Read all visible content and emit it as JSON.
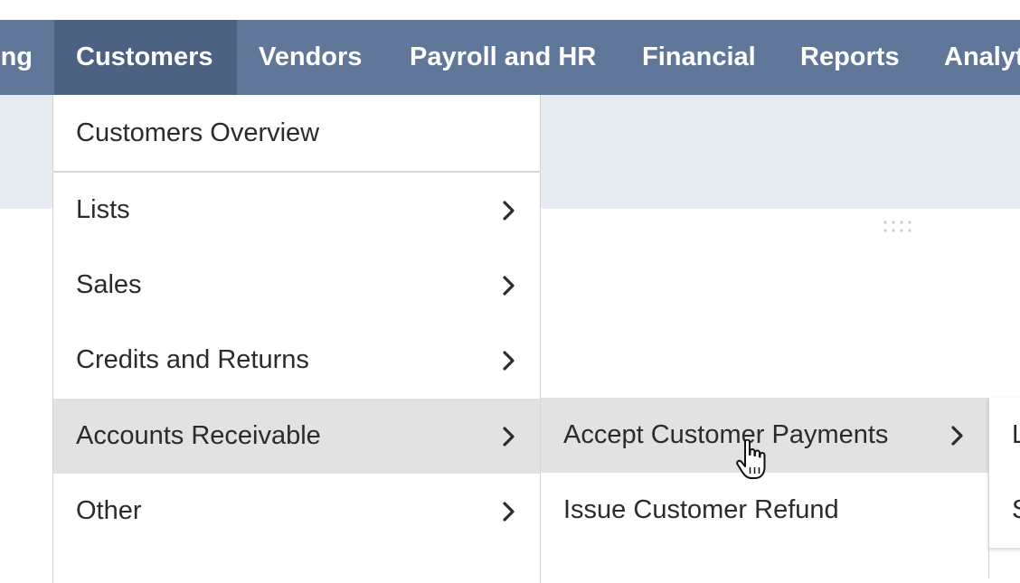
{
  "navbar": {
    "tabs": [
      {
        "label": "ng",
        "active": false
      },
      {
        "label": "Customers",
        "active": true
      },
      {
        "label": "Vendors",
        "active": false
      },
      {
        "label": "Payroll and HR",
        "active": false
      },
      {
        "label": "Financial",
        "active": false
      },
      {
        "label": "Reports",
        "active": false
      },
      {
        "label": "Analyt",
        "active": false
      }
    ]
  },
  "dropdown": {
    "items": [
      {
        "label": "Customers Overview",
        "has_submenu": false
      },
      {
        "label": "Lists",
        "has_submenu": true
      },
      {
        "label": "Sales",
        "has_submenu": true
      },
      {
        "label": "Credits and Returns",
        "has_submenu": true
      },
      {
        "label": "Accounts Receivable",
        "has_submenu": true,
        "hovered": true
      },
      {
        "label": "Other",
        "has_submenu": true
      }
    ]
  },
  "submenu": {
    "items": [
      {
        "label": "Accept Customer Payments",
        "has_submenu": true,
        "hovered": true
      },
      {
        "label": "Issue Customer Refund",
        "has_submenu": false
      }
    ]
  },
  "submenu3": {
    "items": [
      {
        "label": "L"
      },
      {
        "label": "S"
      }
    ]
  },
  "colors": {
    "navbar_bg": "#607799",
    "navbar_active": "#4d6282",
    "header_band": "#e6ebf2",
    "hover_bg": "#e2e2e2"
  },
  "icons": {
    "chevron": "chevron-right-icon",
    "cursor": "hand-pointer-icon",
    "drag": "drag-handle-icon"
  }
}
